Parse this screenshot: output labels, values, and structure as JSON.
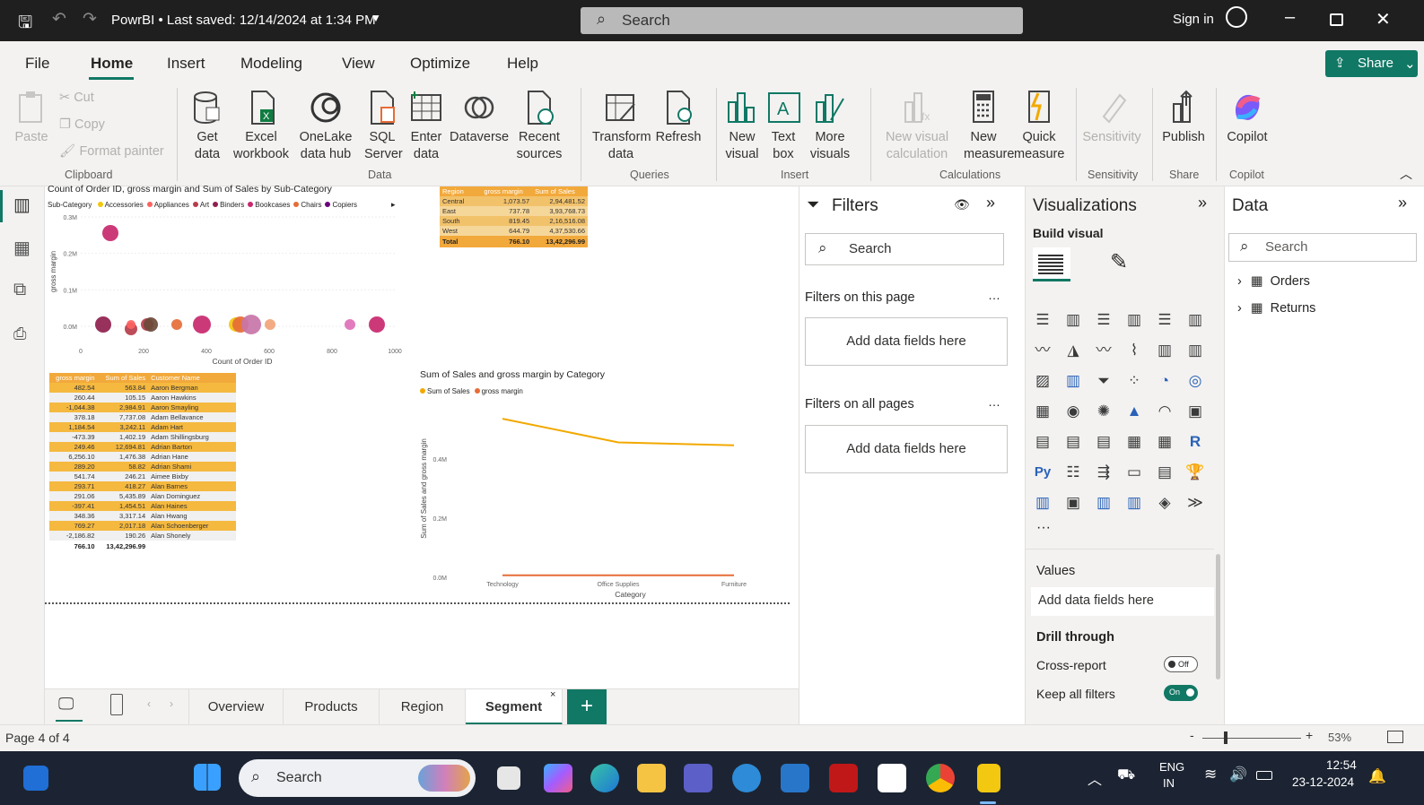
{
  "titlebar": {
    "title": "PowrBI • Last saved: 12/14/2024 at 1:34 PM",
    "search": "Search",
    "sign_in": "Sign in"
  },
  "menu": {
    "file": "File",
    "home": "Home",
    "insert": "Insert",
    "modeling": "Modeling",
    "view": "View",
    "optimize": "Optimize",
    "help": "Help",
    "share": "Share"
  },
  "ribbon": {
    "paste": "Paste",
    "cut": "Cut",
    "copy": "Copy",
    "format_painter": "Format painter",
    "get_data": "Get data",
    "excel": "Excel workbook",
    "onelake": "OneLake data hub",
    "sql": "SQL Server",
    "enter_data": "Enter data",
    "dataverse": "Dataverse",
    "recent": "Recent sources",
    "transform": "Transform data",
    "refresh": "Refresh",
    "new_visual": "New visual",
    "text_box": "Text box",
    "more_visuals": "More visuals",
    "new_visual_calc": "New visual calculation",
    "new_measure": "New measure",
    "quick_measure": "Quick measure",
    "sensitivity": "Sensitivity",
    "publish": "Publish",
    "copilot": "Copilot",
    "groups": {
      "clipboard": "Clipboard",
      "data": "Data",
      "queries": "Queries",
      "insert": "Insert",
      "calculations": "Calculations",
      "sensitivity": "Sensitivity",
      "share": "Share",
      "copilot": "Copilot"
    }
  },
  "scatter": {
    "title": "Count of Order ID, gross margin and Sum of Sales by Sub-Category",
    "legend_label": "Sub-Category",
    "legend": [
      {
        "name": "Accessories",
        "color": "#f2c80f"
      },
      {
        "name": "Appliances",
        "color": "#fd625e"
      },
      {
        "name": "Art",
        "color": "#b73d4b"
      },
      {
        "name": "Binders",
        "color": "#8f1f4e"
      },
      {
        "name": "Bookcases",
        "color": "#c8286e"
      },
      {
        "name": "Chairs",
        "color": "#e66c37"
      },
      {
        "name": "Copiers",
        "color": "#6b007b"
      }
    ],
    "ylabel": "gross margin",
    "xlabel": "Count of Order ID",
    "yticks": [
      "0.3M",
      "0.2M",
      "0.1M",
      "0.0M"
    ],
    "xticks": [
      "0",
      "200",
      "400",
      "600",
      "800",
      "1000"
    ]
  },
  "region_table": {
    "headers": [
      "Region",
      "gross margin",
      "Sum of Sales"
    ],
    "rows": [
      [
        "Central",
        "1,073.57",
        "2,94,481.52"
      ],
      [
        "East",
        "737.78",
        "3,93,768.73"
      ],
      [
        "South",
        "819.45",
        "2,16,516.08"
      ],
      [
        "West",
        "644.79",
        "4,37,530.66"
      ]
    ],
    "total": [
      "Total",
      "766.10",
      "13,42,296.99"
    ]
  },
  "customer_table": {
    "headers": [
      "gross margin",
      "Sum of Sales",
      "Customer Name"
    ],
    "rows": [
      [
        "482.54",
        "563.84",
        "Aaron Bergman"
      ],
      [
        "260.44",
        "105.15",
        "Aaron Hawkins"
      ],
      [
        "-1,044.38",
        "2,984.91",
        "Aaron Smayling"
      ],
      [
        "378.18",
        "7,737.08",
        "Adam Bellavance"
      ],
      [
        "1,184.54",
        "3,242.11",
        "Adam Hart"
      ],
      [
        "-473.39",
        "1,402.19",
        "Adam Shillingsburg"
      ],
      [
        "249.46",
        "12,694.81",
        "Adrian Barton"
      ],
      [
        "6,256.10",
        "1,476.38",
        "Adrian Hane"
      ],
      [
        "289.20",
        "58.82",
        "Adrian Shami"
      ],
      [
        "541.74",
        "246.21",
        "Aimee Bixby"
      ],
      [
        "293.71",
        "418.27",
        "Alan Barnes"
      ],
      [
        "291.06",
        "5,435.89",
        "Alan Dominguez"
      ],
      [
        "-397.41",
        "1,454.51",
        "Alan Haines"
      ],
      [
        "348.36",
        "3,317.14",
        "Alan Hwang"
      ],
      [
        "769.27",
        "2,017.18",
        "Alan Schoenberger"
      ],
      [
        "-2,186.82",
        "190.26",
        "Alan Shonely"
      ]
    ],
    "total": [
      "766.10",
      "13,42,296.99",
      ""
    ]
  },
  "line_chart": {
    "title": "Sum of Sales and gross margin by Category",
    "legend": [
      {
        "name": "Sum of Sales",
        "color": "#f2a900"
      },
      {
        "name": "gross margin",
        "color": "#e66c37"
      }
    ],
    "ylabel": "Sum of Sales and gross margin",
    "xlabel": "Category",
    "yticks": [
      "0.4M",
      "0.2M",
      "0.0M"
    ],
    "categories": [
      "Technology",
      "Office Supplies",
      "Furniture"
    ]
  },
  "chart_data": {
    "type": "line",
    "title": "Sum of Sales and gross margin by Category",
    "categories": [
      "Technology",
      "Office Supplies",
      "Furniture"
    ],
    "series": [
      {
        "name": "Sum of Sales",
        "values": [
          530000,
          450000,
          440000
        ]
      },
      {
        "name": "gross margin",
        "values": [
          700,
          750,
          800
        ]
      }
    ],
    "xlabel": "Category",
    "ylabel": "Sum of Sales and gross margin",
    "ylim": [
      0,
      600000
    ]
  },
  "filters": {
    "title": "Filters",
    "search": "Search",
    "on_page": "Filters on this page",
    "add_fields": "Add data fields here",
    "all_pages": "Filters on all pages",
    "add_fields2": "Add data fields here"
  },
  "viz": {
    "title": "Visualizations",
    "build": "Build visual",
    "values": "Values",
    "add_fields": "Add data fields here",
    "drill": "Drill through",
    "cross_report": "Cross-report",
    "cross_state": "Off",
    "keep_filters": "Keep all filters",
    "keep_state": "On"
  },
  "data_pane": {
    "title": "Data",
    "search": "Search",
    "tables": [
      "Orders",
      "Returns"
    ]
  },
  "pages": {
    "tabs": [
      "Overview",
      "Products",
      "Region",
      "Segment"
    ],
    "active": "Segment"
  },
  "status": {
    "page": "Page 4 of 4",
    "zoom": "53%"
  },
  "taskbar": {
    "search": "Search",
    "lang1": "ENG",
    "lang2": "IN",
    "time": "12:54",
    "date": "23-12-2024"
  }
}
